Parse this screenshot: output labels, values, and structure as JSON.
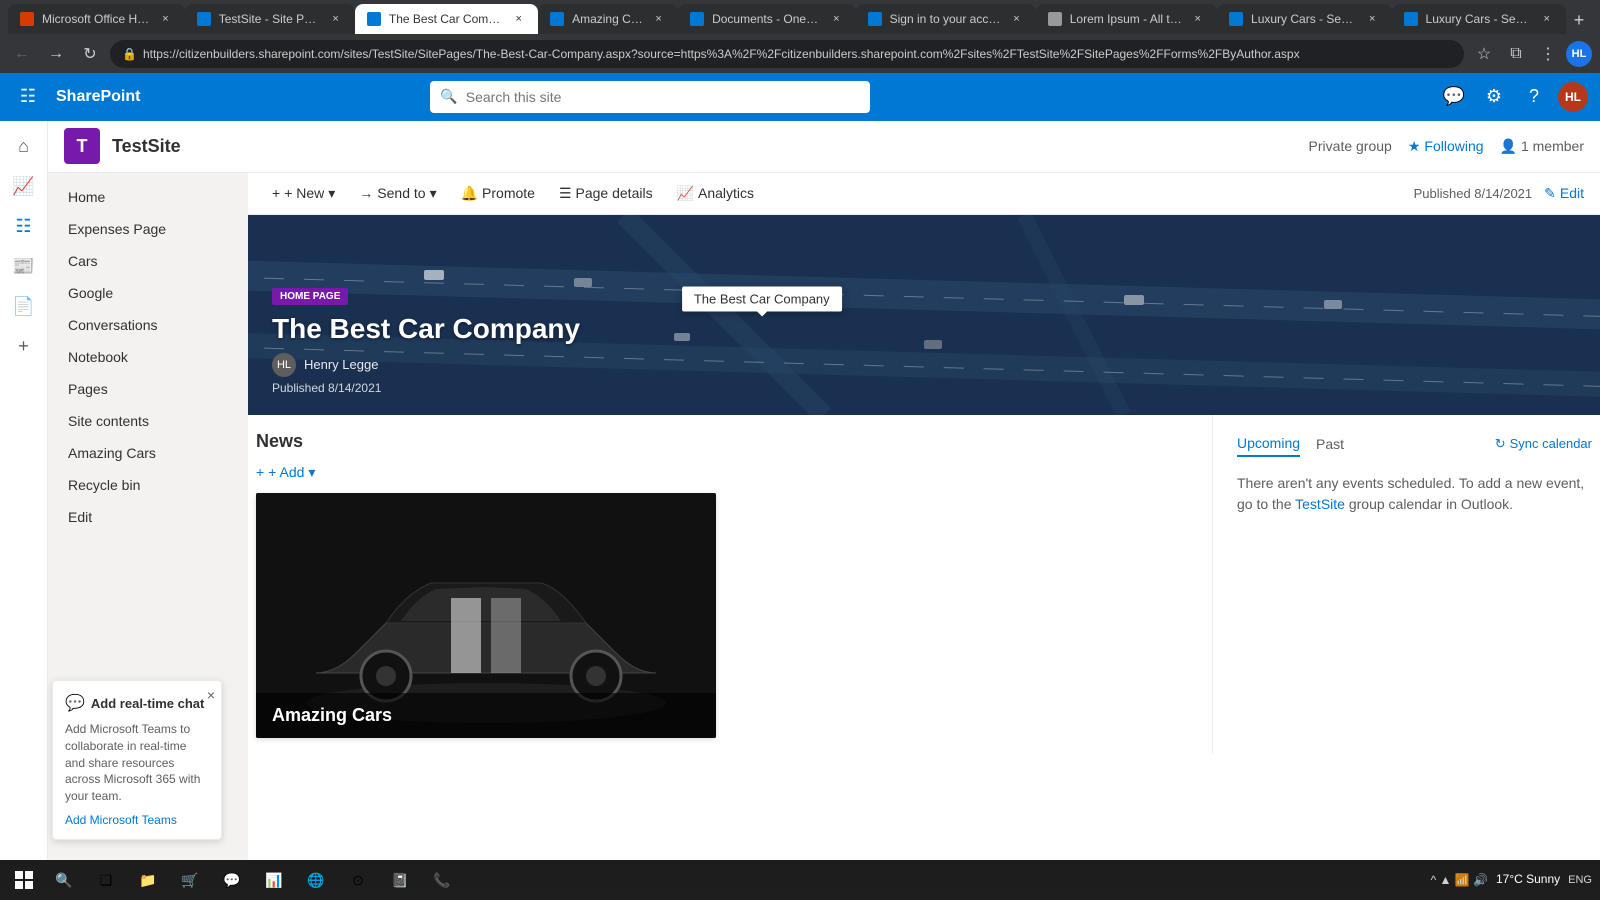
{
  "browser": {
    "tabs": [
      {
        "id": "tab1",
        "title": "Microsoft Office Home",
        "favicon_color": "#d83b01",
        "active": false
      },
      {
        "id": "tab2",
        "title": "TestSite - Site Pages",
        "favicon_color": "#0078d4",
        "active": false
      },
      {
        "id": "tab3",
        "title": "The Best Car Company",
        "favicon_color": "#0078d4",
        "active": true
      },
      {
        "id": "tab4",
        "title": "Amazing Cars",
        "favicon_color": "#0078d4",
        "active": false
      },
      {
        "id": "tab5",
        "title": "Documents - OneDri...",
        "favicon_color": "#0078d4",
        "active": false
      },
      {
        "id": "tab6",
        "title": "Sign in to your accou...",
        "favicon_color": "#0078d4",
        "active": false
      },
      {
        "id": "tab7",
        "title": "Lorem Ipsum - All the...",
        "favicon_color": "#333",
        "active": false
      },
      {
        "id": "tab8",
        "title": "Luxury Cars - Sedans",
        "favicon_color": "#0078d4",
        "active": false
      },
      {
        "id": "tab9",
        "title": "Luxury Cars - Sedans",
        "favicon_color": "#0078d4",
        "active": false
      }
    ],
    "url": "https://citizenbuilders.sharepoint.com/sites/TestSite/SitePages/The-Best-Car-Company.aspx?source=https%3A%2F%2Fcitizenbuilders.sharepoint.com%2Fsites%2FTestSite%2FSitePages%2FForms%2FByAuthor.aspx"
  },
  "sharepoint": {
    "app_name": "SharePoint",
    "search_placeholder": "Search this site",
    "site": {
      "logo_letter": "T",
      "logo_color": "#7719aa",
      "name": "TestSite",
      "meta": {
        "private_group": "Private group",
        "following_star": "★",
        "following_label": "Following",
        "member_count": "1 member"
      }
    },
    "command_bar": {
      "new_label": "+ New",
      "send_to_label": "Send to",
      "promote_label": "Promote",
      "page_details_label": "Page details",
      "analytics_label": "Analytics",
      "published_label": "Published 8/14/2021",
      "edit_label": "Edit"
    },
    "hero": {
      "badge": "HOME PAGE",
      "title": "The Best Car Company",
      "author_name": "Henry Legge",
      "date": "Published 8/14/2021",
      "tooltip": "The Best Car Company"
    },
    "sidebar": {
      "items": [
        {
          "id": "home",
          "label": "Home"
        },
        {
          "id": "expenses",
          "label": "Expenses Page"
        },
        {
          "id": "cars",
          "label": "Cars"
        },
        {
          "id": "google",
          "label": "Google"
        },
        {
          "id": "conversations",
          "label": "Conversations"
        },
        {
          "id": "notebook",
          "label": "Notebook"
        },
        {
          "id": "pages",
          "label": "Pages"
        },
        {
          "id": "site-contents",
          "label": "Site contents"
        },
        {
          "id": "amazing-cars",
          "label": "Amazing Cars"
        },
        {
          "id": "recycle-bin",
          "label": "Recycle bin"
        },
        {
          "id": "edit",
          "label": "Edit"
        }
      ]
    },
    "news": {
      "title": "News",
      "add_label": "+ Add",
      "add_dropdown": "▾",
      "card": {
        "title": "Amazing Cars"
      }
    },
    "events": {
      "tabs": [
        {
          "id": "upcoming",
          "label": "Upcoming",
          "active": true
        },
        {
          "id": "past",
          "label": "Past",
          "active": false
        }
      ],
      "sync_label": "Sync calendar",
      "empty_message": "There aren't any events scheduled. To add a new event, go to the TestSite group calendar in Outlook."
    },
    "chat_widget": {
      "close_label": "×",
      "header": "Add real-time chat",
      "body": "Add Microsoft Teams to collaborate in real-time and share resources across Microsoft 365 with your team.",
      "link": "Add Microsoft Teams"
    }
  },
  "taskbar": {
    "weather": "17°C  Sunny",
    "time": "ENG",
    "icons": [
      "⊞",
      "🔍",
      "❑",
      "📁",
      "🛒",
      "💬",
      "📊"
    ]
  }
}
